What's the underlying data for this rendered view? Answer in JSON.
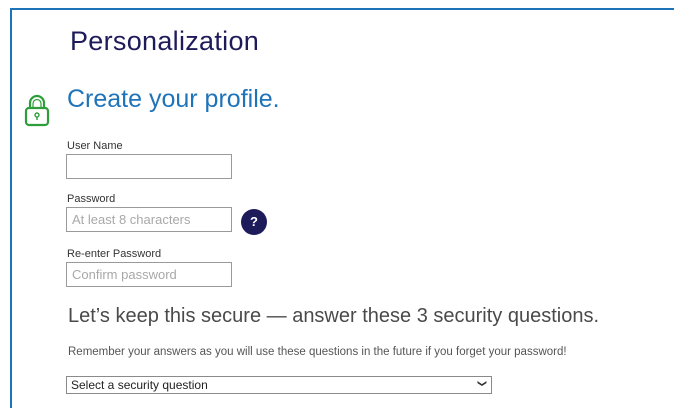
{
  "header": {
    "title": "Personalization"
  },
  "profile": {
    "title": "Create your profile.",
    "username": {
      "label": "User Name",
      "value": "",
      "placeholder": ""
    },
    "password": {
      "label": "Password",
      "value": "",
      "placeholder": "At least 8 characters",
      "help_label": "?"
    },
    "confirm_password": {
      "label": "Re-enter Password",
      "value": "",
      "placeholder": "Confirm password"
    }
  },
  "security": {
    "heading": "Let’s keep this secure — answer these 3 security questions.",
    "note": "Remember your answers as you will use these questions in the future if you forget your password!",
    "question_select": {
      "selected": "Select a security question"
    }
  },
  "colors": {
    "brand_navy": "#1e1b5a",
    "accent_blue": "#1f73b8",
    "lock_green": "#2e9e3a"
  },
  "icons": {
    "lock": "lock-icon",
    "help": "question-mark",
    "select_chevron": "chevron-down-icon"
  }
}
